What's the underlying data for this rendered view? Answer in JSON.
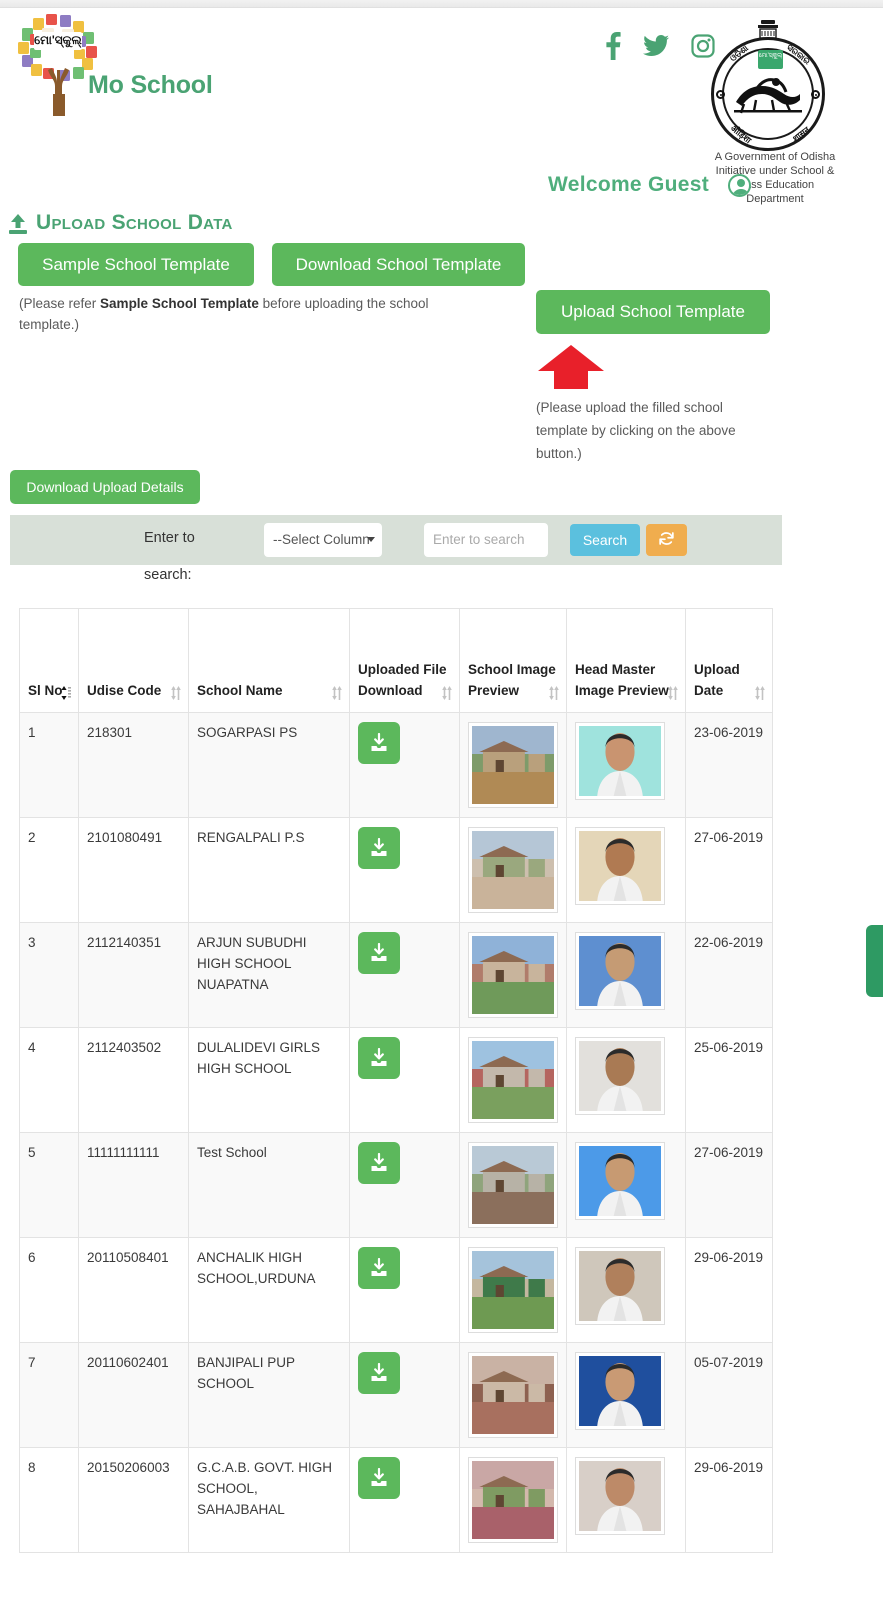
{
  "brand": {
    "name": "Mo School",
    "logo_icon": "mo-school-tree-logo"
  },
  "header": {
    "social": [
      {
        "name": "facebook-icon",
        "label": "Facebook"
      },
      {
        "name": "twitter-icon",
        "label": "Twitter"
      },
      {
        "name": "instagram-icon",
        "label": "Instagram"
      }
    ],
    "emblem": {
      "name": "odisha-government-emblem",
      "top_text": "ଓଡ଼ିଶା ସରକାର",
      "bottom_text": "ଓଡ଼ିଶା ଶାସନ",
      "badge": "ଓଡ଼ିଶା"
    },
    "gov_text": "A Government of Odisha Initiative under School & Mass Education Department",
    "welcome": "Welcome Guest",
    "avatar_icon": "user-avatar-icon"
  },
  "section": {
    "title": "Upload School Data",
    "upload_icon": "upload-icon"
  },
  "buttons": {
    "sample_template": "Sample School Template",
    "download_template": "Download School Template",
    "upload_template": "Upload School Template",
    "download_upload_details": "Download Upload Details"
  },
  "notes": {
    "left_pre": "(Please refer ",
    "left_bold": "Sample School Template",
    "left_post": " before uploading the school template.)",
    "right": "(Please upload the filled school template by clicking on the above button.)",
    "arrow_icon": "red-up-arrow-icon"
  },
  "search": {
    "label_line1": "Enter to",
    "label_line2": "search:",
    "select_value": "--Select Column",
    "input_placeholder": "Enter to search",
    "input_value": "",
    "search_button": "Search",
    "refresh_icon": "refresh-icon"
  },
  "table": {
    "columns": [
      {
        "label": "Sl No",
        "sort": "active"
      },
      {
        "label": "Udise Code",
        "sort": "idle"
      },
      {
        "label": "School Name",
        "sort": "idle"
      },
      {
        "label": "Uploaded File Download",
        "sort": "idle"
      },
      {
        "label": "School Image Preview",
        "sort": "idle"
      },
      {
        "label": "Head Master Image Preview",
        "sort": "idle"
      },
      {
        "label": "Upload Date",
        "sort": "idle"
      }
    ],
    "rows": [
      {
        "sl": "1",
        "udise": "218301",
        "name": "SOGARPASI PS",
        "download_icon": "download-icon",
        "school_image": "school-photo",
        "hm_image": "headmaster-photo",
        "date": "23-06-2019"
      },
      {
        "sl": "2",
        "udise": "2101080491",
        "name": "RENGALPALI P.S",
        "download_icon": "download-icon",
        "school_image": "school-photo",
        "hm_image": "headmaster-photo",
        "date": "27-06-2019"
      },
      {
        "sl": "3",
        "udise": "2112140351",
        "name": "ARJUN SUBUDHI HIGH SCHOOL NUAPATNA",
        "download_icon": "download-icon",
        "school_image": "school-photo",
        "hm_image": "headmaster-photo",
        "date": "22-06-2019"
      },
      {
        "sl": "4",
        "udise": "2112403502",
        "name": "DULALIDEVI GIRLS HIGH SCHOOL",
        "download_icon": "download-icon",
        "school_image": "school-photo",
        "hm_image": "headmaster-photo",
        "date": "25-06-2019"
      },
      {
        "sl": "5",
        "udise": "11111111111",
        "name": "Test School",
        "download_icon": "download-icon",
        "school_image": "school-photo",
        "hm_image": "headmaster-photo",
        "date": "27-06-2019"
      },
      {
        "sl": "6",
        "udise": "20110508401",
        "name": "ANCHALIK HIGH SCHOOL,URDUNA",
        "download_icon": "download-icon",
        "school_image": "school-photo",
        "hm_image": "headmaster-photo",
        "date": "29-06-2019"
      },
      {
        "sl": "7",
        "udise": "20110602401",
        "name": "BANJIPALI PUP SCHOOL",
        "download_icon": "download-icon",
        "school_image": "school-photo",
        "hm_image": "headmaster-photo",
        "date": "05-07-2019"
      },
      {
        "sl": "8",
        "udise": "20150206003",
        "name": "G.C.A.B. GOVT. HIGH SCHOOL, SAHAJBAHAL",
        "download_icon": "download-icon",
        "school_image": "school-photo",
        "hm_image": "headmaster-photo",
        "date": "29-06-2019"
      }
    ]
  },
  "colors": {
    "brand_green": "#4aa373",
    "button_green": "#5cb85c",
    "search_blue": "#5bc0de",
    "refresh_orange": "#f0ad4e",
    "arrow_red": "#e8202a",
    "searchbar_bg": "#d8e0d8"
  },
  "edge_tab": {
    "name": "side-tab"
  }
}
